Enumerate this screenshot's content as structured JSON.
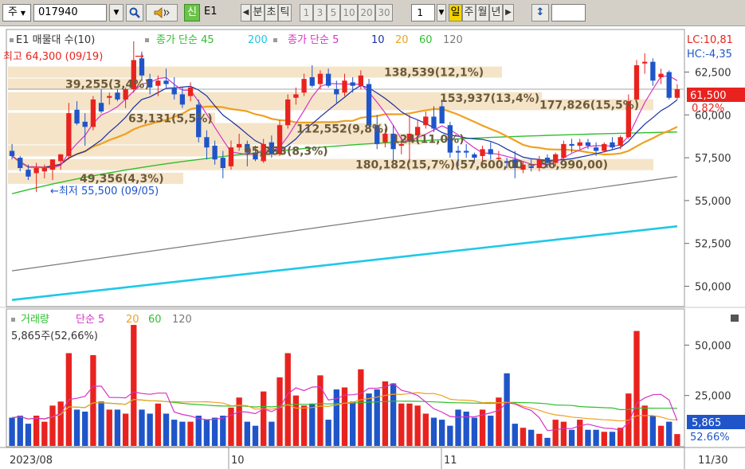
{
  "toolbar": {
    "market": "주",
    "code": "017940",
    "badge": "신",
    "name": "E1",
    "tab_minute": "분",
    "tab_second": "초",
    "tab_tick": "틱",
    "periods": [
      "1",
      "3",
      "5",
      "10",
      "20",
      "30"
    ],
    "count": "1",
    "tab_day": "일",
    "tab_week": "주",
    "tab_month": "월",
    "tab_year": "년"
  },
  "legend": {
    "price_title": "E1 매물대 수(10)",
    "ma_long_label": "종가 단순 45",
    "ma_long_extra": "200",
    "ma_short_label": "종가 단순 5",
    "ma_short_others": [
      "10",
      "20",
      "60",
      "120"
    ],
    "vol_title": "거래량",
    "vol_ma_label": "단순 5",
    "vol_ma_others": [
      "20",
      "60",
      "120"
    ],
    "vol_current": "5,865주(52,66%)"
  },
  "markers": {
    "high": "최고 64,300 (09/19)",
    "low": "←최저 55,500 (09/05)",
    "high_arrow": "→"
  },
  "right_panel": {
    "lc": "LC:10,81",
    "hc": "HC:-4,35",
    "last_price": "61,500",
    "change": "0.82%",
    "last_volume": "5,865",
    "volume_ratio": "52.66%"
  },
  "axis": {
    "price_ticks": [
      "62,500",
      "60,000",
      "57,500",
      "55,000",
      "52,500",
      "50,000"
    ],
    "volume_ticks": [
      "50,000",
      "25,000"
    ],
    "x_labels": [
      "2023/08",
      "10",
      "11",
      "11/30"
    ]
  },
  "colors": {
    "up": "#e8231f",
    "down": "#1f55c9",
    "ma5": "#d633c6",
    "ma10": "#1a2fa0",
    "ma20": "#f0a020",
    "ma60": "#2fbf2f",
    "ma120": "#7a7a7a",
    "ma200": "#1ec8e8",
    "vp_bar": "#f5e4c8"
  },
  "chart_data": {
    "type": "candlestick",
    "dates_start": "2023/08",
    "dates_end": "11/30",
    "price_ylim": [
      49000,
      64800
    ],
    "volume_ylim": [
      0,
      62000
    ],
    "candles": [
      {
        "o": 57900,
        "h": 58300,
        "l": 57400,
        "c": 57600,
        "v": 14000
      },
      {
        "o": 57500,
        "h": 57600,
        "l": 56700,
        "c": 56900,
        "v": 15000
      },
      {
        "o": 56800,
        "h": 57100,
        "l": 56200,
        "c": 56400,
        "v": 11000
      },
      {
        "o": 56600,
        "h": 57200,
        "l": 55500,
        "c": 56900,
        "v": 15000
      },
      {
        "o": 56700,
        "h": 57100,
        "l": 56300,
        "c": 56900,
        "v": 12000
      },
      {
        "o": 56800,
        "h": 57400,
        "l": 56200,
        "c": 57400,
        "v": 20000
      },
      {
        "o": 57300,
        "h": 57700,
        "l": 56800,
        "c": 57700,
        "v": 22000
      },
      {
        "o": 57600,
        "h": 60700,
        "l": 57400,
        "c": 60100,
        "v": 46000
      },
      {
        "o": 60300,
        "h": 60800,
        "l": 59400,
        "c": 59500,
        "v": 18000
      },
      {
        "o": 59600,
        "h": 60100,
        "l": 58200,
        "c": 59300,
        "v": 17000
      },
      {
        "o": 59300,
        "h": 61100,
        "l": 59100,
        "c": 60900,
        "v": 45000
      },
      {
        "o": 60700,
        "h": 61500,
        "l": 60100,
        "c": 60200,
        "v": 22000
      },
      {
        "o": 61000,
        "h": 61300,
        "l": 60600,
        "c": 61100,
        "v": 18000
      },
      {
        "o": 61300,
        "h": 61500,
        "l": 60800,
        "c": 60900,
        "v": 18000
      },
      {
        "o": 60900,
        "h": 61600,
        "l": 60400,
        "c": 61500,
        "v": 16000
      },
      {
        "o": 61500,
        "h": 64300,
        "l": 61300,
        "c": 63200,
        "v": 60000
      },
      {
        "o": 63300,
        "h": 63700,
        "l": 62000,
        "c": 62300,
        "v": 18000
      },
      {
        "o": 62100,
        "h": 62400,
        "l": 61200,
        "c": 61600,
        "v": 16000
      },
      {
        "o": 61700,
        "h": 62300,
        "l": 61100,
        "c": 62000,
        "v": 21000
      },
      {
        "o": 62000,
        "h": 62700,
        "l": 61600,
        "c": 61800,
        "v": 16000
      },
      {
        "o": 61600,
        "h": 62200,
        "l": 60900,
        "c": 61200,
        "v": 13000
      },
      {
        "o": 61200,
        "h": 61600,
        "l": 60400,
        "c": 60600,
        "v": 12000
      },
      {
        "o": 61100,
        "h": 61900,
        "l": 60800,
        "c": 61600,
        "v": 12000
      },
      {
        "o": 60600,
        "h": 60900,
        "l": 58400,
        "c": 58700,
        "v": 15000
      },
      {
        "o": 58700,
        "h": 59100,
        "l": 57400,
        "c": 58100,
        "v": 13000
      },
      {
        "o": 58200,
        "h": 58500,
        "l": 57100,
        "c": 57400,
        "v": 14000
      },
      {
        "o": 57500,
        "h": 57900,
        "l": 56300,
        "c": 56900,
        "v": 15000
      },
      {
        "o": 57000,
        "h": 58500,
        "l": 56800,
        "c": 58100,
        "v": 19000
      },
      {
        "o": 58100,
        "h": 58900,
        "l": 57900,
        "c": 58300,
        "v": 24000
      },
      {
        "o": 58300,
        "h": 58500,
        "l": 57000,
        "c": 57800,
        "v": 12000
      },
      {
        "o": 57800,
        "h": 58200,
        "l": 57300,
        "c": 57400,
        "v": 10000
      },
      {
        "o": 57300,
        "h": 58600,
        "l": 57200,
        "c": 58300,
        "v": 27000
      },
      {
        "o": 58400,
        "h": 58800,
        "l": 57500,
        "c": 57700,
        "v": 12000
      },
      {
        "o": 57700,
        "h": 59700,
        "l": 57600,
        "c": 59400,
        "v": 34000
      },
      {
        "o": 59400,
        "h": 61200,
        "l": 59200,
        "c": 60900,
        "v": 46000
      },
      {
        "o": 61000,
        "h": 61600,
        "l": 60600,
        "c": 61200,
        "v": 25000
      },
      {
        "o": 61300,
        "h": 62400,
        "l": 61100,
        "c": 62100,
        "v": 20000
      },
      {
        "o": 62200,
        "h": 62900,
        "l": 61600,
        "c": 61700,
        "v": 21000
      },
      {
        "o": 61800,
        "h": 62600,
        "l": 61500,
        "c": 62400,
        "v": 35000
      },
      {
        "o": 62400,
        "h": 62700,
        "l": 61600,
        "c": 61700,
        "v": 13000
      },
      {
        "o": 61500,
        "h": 62000,
        "l": 60700,
        "c": 61200,
        "v": 28000
      },
      {
        "o": 61300,
        "h": 62400,
        "l": 61100,
        "c": 62000,
        "v": 29000
      },
      {
        "o": 61900,
        "h": 62200,
        "l": 61300,
        "c": 61700,
        "v": 22000
      },
      {
        "o": 61700,
        "h": 62600,
        "l": 61500,
        "c": 62300,
        "v": 38000
      },
      {
        "o": 61800,
        "h": 62100,
        "l": 59200,
        "c": 59400,
        "v": 26000
      },
      {
        "o": 59400,
        "h": 60000,
        "l": 58000,
        "c": 58300,
        "v": 28000
      },
      {
        "o": 58400,
        "h": 59200,
        "l": 58100,
        "c": 58900,
        "v": 32000
      },
      {
        "o": 58900,
        "h": 59400,
        "l": 57300,
        "c": 58000,
        "v": 31000
      },
      {
        "o": 58200,
        "h": 58700,
        "l": 57700,
        "c": 58300,
        "v": 21000
      },
      {
        "o": 58500,
        "h": 60000,
        "l": 57200,
        "c": 58900,
        "v": 21000
      },
      {
        "o": 58800,
        "h": 59700,
        "l": 58500,
        "c": 59300,
        "v": 20000
      },
      {
        "o": 59400,
        "h": 60200,
        "l": 59200,
        "c": 59900,
        "v": 16000
      },
      {
        "o": 59900,
        "h": 60500,
        "l": 59000,
        "c": 59200,
        "v": 14000
      },
      {
        "o": 60500,
        "h": 60900,
        "l": 59500,
        "c": 59500,
        "v": 13000
      },
      {
        "o": 59400,
        "h": 59600,
        "l": 57500,
        "c": 57800,
        "v": 10000
      },
      {
        "o": 57900,
        "h": 58200,
        "l": 57000,
        "c": 57800,
        "v": 18000
      },
      {
        "o": 57900,
        "h": 58300,
        "l": 57500,
        "c": 57800,
        "v": 17000
      },
      {
        "o": 57700,
        "h": 57800,
        "l": 57200,
        "c": 57500,
        "v": 14000
      },
      {
        "o": 57600,
        "h": 58200,
        "l": 57300,
        "c": 58000,
        "v": 18000
      },
      {
        "o": 58000,
        "h": 58400,
        "l": 57400,
        "c": 57700,
        "v": 15000
      },
      {
        "o": 57500,
        "h": 57900,
        "l": 57300,
        "c": 57500,
        "v": 24000
      },
      {
        "o": 57300,
        "h": 57500,
        "l": 56900,
        "c": 57200,
        "v": 36000
      },
      {
        "o": 57400,
        "h": 57900,
        "l": 56300,
        "c": 56900,
        "v": 11000
      },
      {
        "o": 56800,
        "h": 57300,
        "l": 56600,
        "c": 57100,
        "v": 9000
      },
      {
        "o": 57000,
        "h": 57400,
        "l": 56700,
        "c": 56900,
        "v": 8000
      },
      {
        "o": 56900,
        "h": 57600,
        "l": 56700,
        "c": 57400,
        "v": 6000
      },
      {
        "o": 57500,
        "h": 57700,
        "l": 56900,
        "c": 57200,
        "v": 4000
      },
      {
        "o": 57200,
        "h": 57800,
        "l": 57000,
        "c": 57700,
        "v": 13000
      },
      {
        "o": 57500,
        "h": 58500,
        "l": 57300,
        "c": 58300,
        "v": 12000
      },
      {
        "o": 58300,
        "h": 58600,
        "l": 57800,
        "c": 58200,
        "v": 8000
      },
      {
        "o": 58200,
        "h": 58600,
        "l": 58000,
        "c": 58400,
        "v": 13000
      },
      {
        "o": 58400,
        "h": 58600,
        "l": 58000,
        "c": 58200,
        "v": 8000
      },
      {
        "o": 58100,
        "h": 58400,
        "l": 57600,
        "c": 57900,
        "v": 8000
      },
      {
        "o": 57900,
        "h": 58400,
        "l": 57800,
        "c": 58300,
        "v": 7000
      },
      {
        "o": 58400,
        "h": 58700,
        "l": 58000,
        "c": 58100,
        "v": 7000
      },
      {
        "o": 58200,
        "h": 58800,
        "l": 58000,
        "c": 58700,
        "v": 9000
      },
      {
        "o": 58700,
        "h": 61200,
        "l": 58600,
        "c": 60800,
        "v": 26000
      },
      {
        "o": 60900,
        "h": 63200,
        "l": 60800,
        "c": 62900,
        "v": 57000
      },
      {
        "o": 63000,
        "h": 63600,
        "l": 62400,
        "c": 63100,
        "v": 20000
      },
      {
        "o": 63100,
        "h": 63300,
        "l": 61700,
        "c": 62000,
        "v": 15000
      },
      {
        "o": 62200,
        "h": 62700,
        "l": 61800,
        "c": 62400,
        "v": 10000
      },
      {
        "o": 62500,
        "h": 62600,
        "l": 60900,
        "c": 61000,
        "v": 12000
      },
      {
        "o": 61000,
        "h": 61800,
        "l": 60900,
        "c": 61500,
        "v": 5865
      }
    ],
    "volume_profile": [
      {
        "price": 62500,
        "label": "138,539(12,1%)"
      },
      {
        "price": 61800,
        "label": "39,255(3,4%)"
      },
      {
        "price": 61000,
        "label": "153,937(13,4%)"
      },
      {
        "price": 60600,
        "label": "177,826(15,5%)"
      },
      {
        "price": 59800,
        "label": "63,131(5,5%)"
      },
      {
        "price": 59200,
        "label": "112,552(9,8%)"
      },
      {
        "price": 58600,
        "label": "124(11,0%)"
      },
      {
        "price": 57900,
        "label": "95,253(8,3%)"
      },
      {
        "price": 57100,
        "label": "180,182(15,7%)(57,600,00 ~ 56,990,00)"
      },
      {
        "price": 56300,
        "label": "49,356(4,3%)"
      }
    ],
    "ma120": [
      {
        "i": 0,
        "v": 50900
      },
      {
        "i": 82,
        "v": 56400
      }
    ],
    "ma200": [
      {
        "i": 0,
        "v": 49200
      },
      {
        "i": 82,
        "v": 53500
      }
    ],
    "vol_ma_lines": {
      "ma5_label": "단순 5",
      "ma20_label": "20",
      "ma60_label": "60"
    }
  }
}
